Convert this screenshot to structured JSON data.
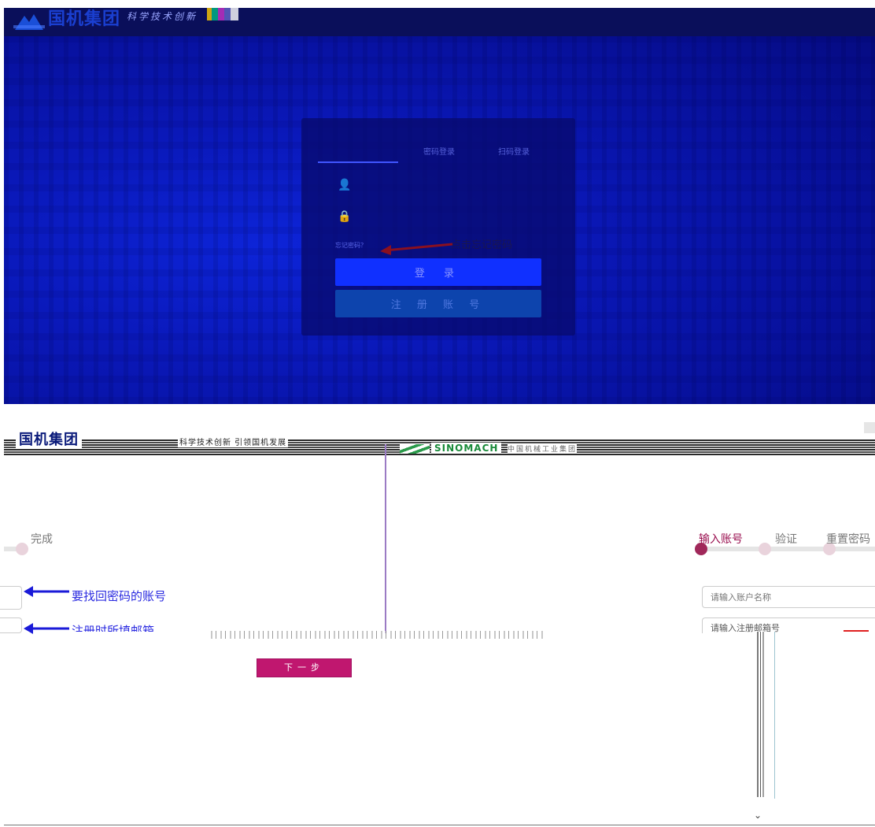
{
  "top": {
    "logo_text": "国机集团",
    "slogan": "科学技术创新",
    "tabs": [
      "密码登录",
      "扫码登录"
    ],
    "forgot_password": "忘记密码？",
    "login_button": "登 录",
    "register_button": "注 册 账 号",
    "annotation": "点击忘记密码"
  },
  "bottom": {
    "logo_text": "国机集团",
    "slogan": "科学技术创新 引领国机发展",
    "brand": "SINOMACH",
    "brand_tagline": "中国机械工业集团",
    "steps": [
      "输入账号",
      "验证",
      "重置密码",
      "完成"
    ],
    "annotation_account": "要找回密码的账号",
    "annotation_email": "注册时所填邮箱",
    "account_placeholder": "请输入账户名称",
    "email_placeholder": "请输入注册邮箱号",
    "next_button": "下一步",
    "scroll_down_icon": "chevron-down-icon"
  },
  "colors": {
    "top_background": "#0a18b8",
    "login_button": "#1030ff",
    "active_step": "#9a1050",
    "next_button": "#c0176f",
    "annotation_text": "#2a2ae0"
  }
}
